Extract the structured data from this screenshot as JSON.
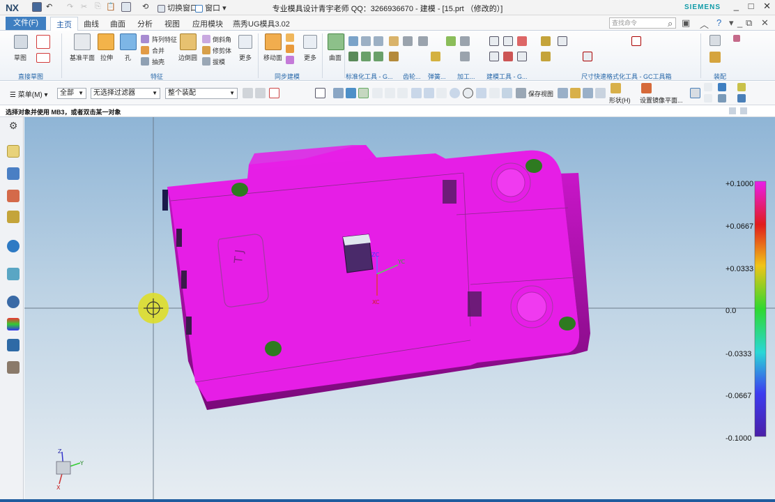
{
  "titlebar": {
    "logo": "NX",
    "switch_window": "切换窗口",
    "window_menu": "窗口",
    "title": "专业模具设计青宇老师 QQ：3266936670 - 建模 - [15.prt （修改的）]",
    "brand": "SIEMENS",
    "minimize": "_",
    "maximize": "□",
    "close": "✕"
  },
  "menu": {
    "file": "文件(F)",
    "tabs": [
      "主页",
      "曲线",
      "曲面",
      "分析",
      "视图",
      "应用模块",
      "燕秀UG模具3.02"
    ],
    "active_tab": "主页",
    "search_placeholder": "查找命令"
  },
  "ribbon": {
    "sketch": {
      "label": "草图",
      "group": "直接草图"
    },
    "features": {
      "datum_plane": "基准平面",
      "extrude": "拉伸",
      "hole": "孔",
      "pattern": "阵列特征",
      "unite": "合并",
      "shell": "抽壳",
      "edge_blend": "边倒圆",
      "chamfer": "倒斜角",
      "trim_body": "修剪体",
      "draft": "拔模",
      "more": "更多",
      "group": "特征"
    },
    "sync": {
      "move_face": "移动面",
      "more": "更多",
      "group": "同步建模"
    },
    "surface": {
      "label": "曲面"
    },
    "groups_right": [
      "标准化工具 - G...",
      "齿轮...",
      "弹簧...",
      "加工...",
      "建模工具 - G...",
      "尺寸快速格式化工具 - GC工具箱",
      "装配"
    ]
  },
  "filterbar": {
    "menu": "菜单(M)",
    "type_filter": "全部",
    "selection_filter": "无选择过滤器",
    "scope": "整个装配",
    "save_view": "保存视图",
    "shape": "形状(H)",
    "mirror": "设置镜像平面..."
  },
  "cue_line": "选择对象并使用 MB3，或者双击某一对象",
  "viewport": {
    "embossed_text": "T J",
    "wcs_xc": "XC",
    "wcs_yc": "YC",
    "wcs_zc": "ZC",
    "triad_x": "X",
    "triad_y": "Y",
    "triad_z": "Z"
  },
  "legend": {
    "labels": [
      "+0.1000",
      "+0.0667",
      "+0.0333",
      "0.0",
      "-0.0333",
      "-0.0667",
      "-0.1000"
    ],
    "gradient_colors": [
      "#e91fe9",
      "#e11c1c",
      "#f0c418",
      "#2fd82f",
      "#2ad7d6",
      "#3c3cf0",
      "#4a1fa8"
    ]
  },
  "colors": {
    "part": "#e61ee6",
    "accent": "#3f7fc1",
    "hole": "#2e7a20",
    "cursor": "#dede2a"
  }
}
